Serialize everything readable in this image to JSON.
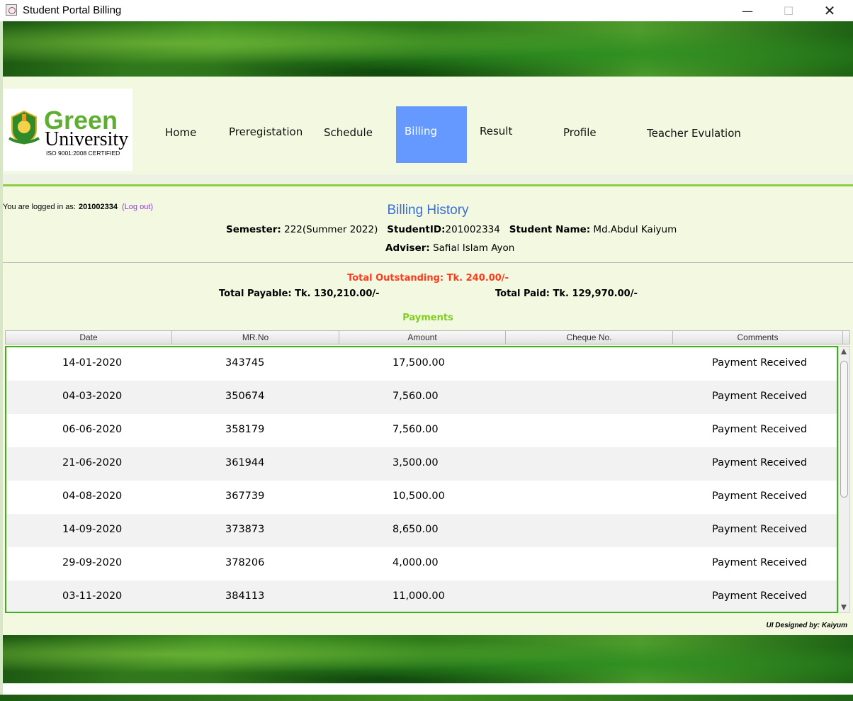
{
  "window": {
    "title": "Student Portal Billing",
    "minimize": "—",
    "maximize": "☐",
    "close": "✕"
  },
  "logo": {
    "line1": "Green",
    "line2": "University",
    "line3": "ISO 9001:2008 CERTIFIED"
  },
  "nav": {
    "items": [
      "Home",
      "Preregistation",
      "Schedule",
      "Billing",
      "Result",
      "Profile",
      "Teacher Evulation"
    ],
    "active": "Billing"
  },
  "login": {
    "prefix": "You are logged in as:",
    "user_id": "201002334",
    "logout": "(Log out)"
  },
  "header": {
    "title": "Billing History",
    "semester_label": "Semester:",
    "semester_value": "222(Summer 2022)",
    "student_id_label": "StudentID:",
    "student_id_value": "201002334",
    "student_name_label": "Student Name:",
    "student_name_value": "Md.Abdul Kaiyum",
    "adviser_label": "Adviser:",
    "adviser_value": "Safial Islam Ayon"
  },
  "summary": {
    "outstanding": "Total Outstanding: Tk. 240.00/-",
    "payable": "Total Payable: Tk. 130,210.00/-",
    "paid": "Total Paid: Tk. 129,970.00/-"
  },
  "payments": {
    "title": "Payments",
    "columns": [
      "Date",
      "MR.No",
      "Amount",
      "Cheque No.",
      "Comments"
    ],
    "rows": [
      [
        "14-01-2020",
        "343745",
        "17,500.00",
        "",
        "Payment Received"
      ],
      [
        "04-03-2020",
        "350674",
        "7,560.00",
        "",
        "Payment Received"
      ],
      [
        "06-06-2020",
        "358179",
        "7,560.00",
        "",
        "Payment Received"
      ],
      [
        "21-06-2020",
        "361944",
        "3,500.00",
        "",
        "Payment Received"
      ],
      [
        "04-08-2020",
        "367739",
        "10,500.00",
        "",
        "Payment Received"
      ],
      [
        "14-09-2020",
        "373873",
        "8,650.00",
        "",
        "Payment Received"
      ],
      [
        "29-09-2020",
        "378206",
        "4,000.00",
        "",
        "Payment Received"
      ],
      [
        "03-11-2020",
        "384113",
        "11,000.00",
        "",
        "Payment Received"
      ]
    ]
  },
  "footer": {
    "credit": "UI Designed by: Kaiyum"
  },
  "colors": {
    "nav_active": "#6699ff",
    "outstanding": "#ff3a1a",
    "heading": "#3b6fd8",
    "payments": "#7ecf1e",
    "table_border": "#3fae1f"
  }
}
